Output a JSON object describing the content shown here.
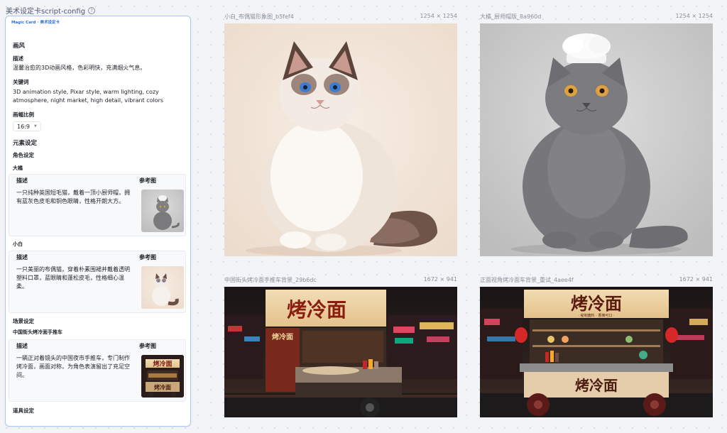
{
  "header": {
    "title": "美术设定卡script-config",
    "help_icon": "question-circle-icon"
  },
  "card": {
    "tag": "Magic Card · 美术设定卡",
    "style_section": {
      "title": "画风",
      "desc_label": "描述",
      "desc_text": "温馨治愈的3D动画风格，色彩明快，充满烟火气息。",
      "keywords_label": "关键词",
      "keywords_text": "3D animation style, Pixar style, warm lighting, cozy atmosphere, night market, high detail, vibrant colors",
      "ratio_label": "画幅比例",
      "ratio_value": "16:9"
    },
    "elements_title": "元素设定",
    "characters_title": "角色设定",
    "characters": [
      {
        "name": "大橘",
        "desc_header": "描述",
        "ref_header": "参考图",
        "desc": "一只纯种英国短毛猫，戴着一顶小厨师帽，拥有蓝灰色皮毛和铜色眼睛，性格开朗大方。"
      },
      {
        "name": "小白",
        "desc_header": "描述",
        "ref_header": "参考图",
        "desc": "一只美丽的布偶猫，穿着朴素围裙并戴着透明塑料口罩，蓝眼睛和蓬松皮毛，性格细心温柔。"
      }
    ],
    "scenes_title": "场景设定",
    "scenes": [
      {
        "name": "中国街头烤冷面手推车",
        "desc_header": "描述",
        "ref_header": "参考图",
        "desc": "一辆正对着镜头的中国夜市手推车，专门制作烤冷面，画面对称，为角色表演留出了充足空间。"
      }
    ],
    "props_title": "道具设定"
  },
  "gallery": [
    {
      "label": "小白_布偶猫形象图_b5fef4",
      "dims": "1254 × 1254"
    },
    {
      "label": "大橘_厨师帽版_8a960d",
      "dims": "1254 × 1254"
    },
    {
      "label": "中国街头烤冷面手推车背景_29b6dc",
      "dims": "1672 × 941"
    },
    {
      "label": "正面视角烤冷面车背景_重试_4aee4f",
      "dims": "1672 × 941"
    }
  ],
  "sign_text": "烤冷面",
  "sign_side": "烤冷面",
  "sign_sub": "· 秘制酱料 · 香辣可口 ·",
  "sign_front": "烤冷面",
  "colors": {
    "accent": "#2f6fd6",
    "card_border": "#a9c7f2",
    "muted_text": "#86909c"
  }
}
